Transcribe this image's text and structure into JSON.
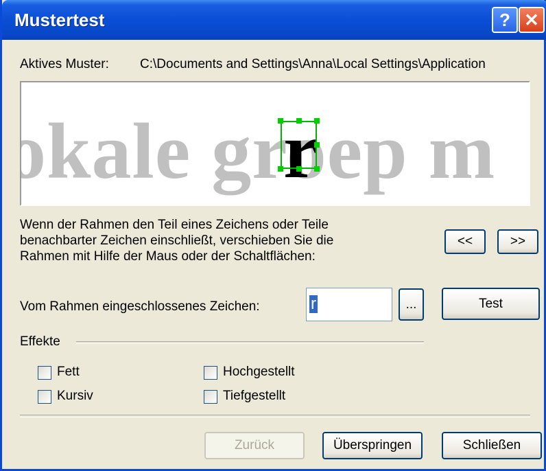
{
  "window": {
    "title": "Mustertest",
    "help_label": "?",
    "close_label": "✕"
  },
  "pattern": {
    "label": "Aktives Muster:",
    "path": "C:\\Documents and Settings\\Anna\\Local Settings\\Application"
  },
  "preview": {
    "sample_text": "okale groep m",
    "selected_char": "r"
  },
  "instructions": {
    "line1": "Wenn der Rahmen den Teil eines Zeichens oder Teile",
    "line2": "benachbarter Zeichen einschließt, verschieben Sie die",
    "line3": "Rahmen mit Hilfe der Maus oder der Schaltflächen:"
  },
  "nav": {
    "prev_label": "<<",
    "next_label": ">>"
  },
  "char_field": {
    "label": "Vom Rahmen eingeschlossenes Zeichen:",
    "value": "r",
    "browse_label": "...",
    "test_label": "Test"
  },
  "effects": {
    "group_label": "Effekte",
    "options": [
      {
        "label": "Fett",
        "checked": false
      },
      {
        "label": "Kursiv",
        "checked": false
      },
      {
        "label": "Hochgestellt",
        "checked": false
      },
      {
        "label": "Tiefgestellt",
        "checked": false
      }
    ]
  },
  "footer": {
    "back_label": "Zurück",
    "skip_label": "Überspringen",
    "close_label": "Schließen"
  },
  "colors": {
    "titlebar": "#0a4ed6",
    "selection_frame": "#00b400",
    "sample_text": "#c0c0c0",
    "dialog_bg": "#ece9d8"
  }
}
